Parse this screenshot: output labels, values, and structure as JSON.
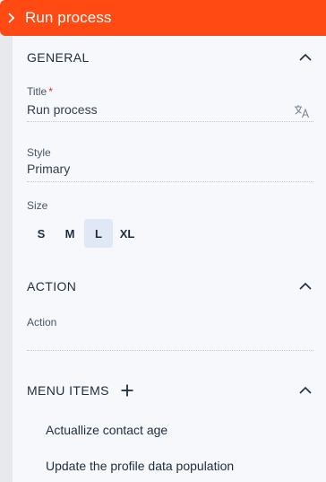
{
  "header": {
    "title": "Run process",
    "collapse_icon": "chevron-right-icon"
  },
  "general": {
    "heading": "GENERAL",
    "title_field": {
      "label": "Title",
      "required_mark": "*",
      "value": "Run process"
    },
    "style_field": {
      "label": "Style",
      "value": "Primary"
    },
    "size_field": {
      "label": "Size",
      "options": [
        "S",
        "M",
        "L",
        "XL"
      ],
      "selected": "L"
    }
  },
  "action": {
    "heading": "ACTION",
    "action_field": {
      "label": "Action",
      "value": ""
    }
  },
  "menu_items": {
    "heading": "MENU ITEMS",
    "items": [
      "Actuallize contact age",
      "Update the profile data population"
    ]
  },
  "colors": {
    "accent": "#ff4a13",
    "panel_bg": "#f6f8fb",
    "selected_size_bg": "#e1e8f5"
  }
}
